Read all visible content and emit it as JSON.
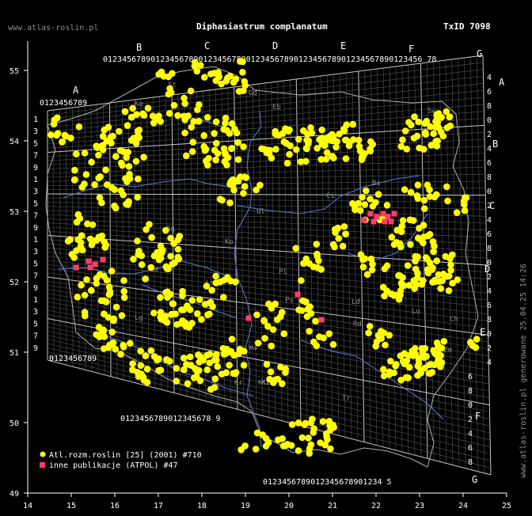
{
  "header": {
    "site": "www.atlas-roslin.pl",
    "species": "Diphasiastrum complanatum",
    "taxid": "TxID 7098"
  },
  "axes": {
    "lon_ticks": [
      "14",
      "15",
      "16",
      "17",
      "18",
      "19",
      "20",
      "21",
      "22",
      "23",
      "24",
      "25"
    ],
    "lat_ticks": [
      "55",
      "54",
      "53",
      "52",
      "51",
      "50",
      "49"
    ]
  },
  "grid_letters": {
    "top": [
      "A",
      "B",
      "C",
      "D",
      "E",
      "F",
      "G"
    ],
    "right": [
      "A",
      "B",
      "C",
      "D",
      "E",
      "F",
      "G"
    ]
  },
  "grid_digits": {
    "top_row": "0123456789012345678901234567890123456789012345678901234567890123456 78",
    "row_a": "0123456789",
    "bottom_row_left": "0123456789012345678 9",
    "bottom_row_right": "0123456789012345678901234 5",
    "left_col": [
      "1",
      "3",
      "5",
      "7",
      "9",
      "1",
      "3",
      "5",
      "7",
      "9",
      "1",
      "3",
      "5",
      "7",
      "9",
      "1",
      "3",
      "5",
      "7",
      "9"
    ],
    "right_col": [
      "4",
      "6",
      "8",
      "0",
      "2",
      "4",
      "6",
      "8",
      "0",
      "2",
      "4",
      "6",
      "8",
      "0",
      "2",
      "4",
      "6",
      "8",
      "0",
      "2",
      "4",
      "6",
      "8",
      "0",
      "2",
      "4",
      "6",
      "8"
    ]
  },
  "regions": [
    "St",
    "Ko",
    "Eb",
    "Sw",
    "Gd",
    "Ol",
    "Ci",
    "Bi",
    "Ko",
    "Pl",
    "Ps",
    "Ld",
    "Wa",
    "Lu",
    "Rd",
    "Ki",
    "Kt",
    "Tr",
    "Op",
    "Wr",
    "Lg",
    "Le",
    "Zm",
    "Ch",
    "Kr",
    "Ls",
    "Bg"
  ],
  "legend": {
    "items": [
      {
        "label": "Atl.rozm.roslin [25] (2001) #710",
        "color": "#ffff00",
        "shape": "circle"
      },
      {
        "label": "inne publikacje (ATPOL) #47",
        "color": "#ff3c6e",
        "shape": "square"
      }
    ]
  },
  "side_note": "www.atlas-roslin.pl generowane 25.04.25 14:26",
  "colors": {
    "background": "#000000",
    "grid": "#8c8c8c",
    "rivers": "#5a7fd0",
    "border": "#b0b0b0",
    "atlas_points": "#ffff00",
    "other_points": "#ff3c6e"
  }
}
